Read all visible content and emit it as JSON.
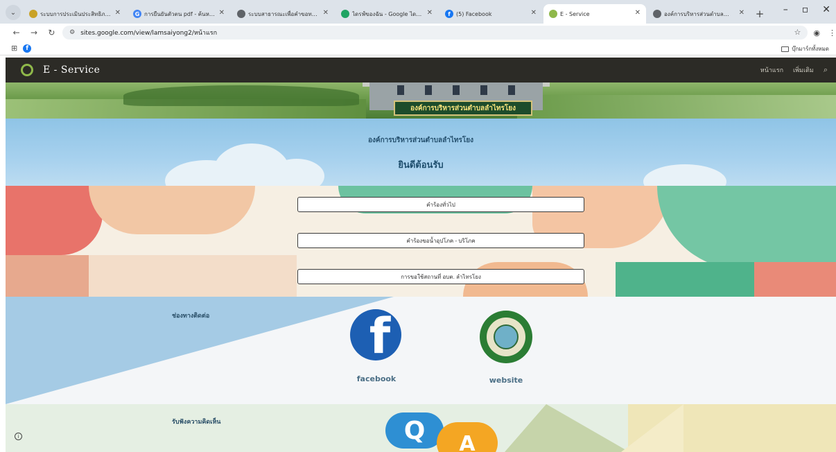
{
  "browser": {
    "tabs": [
      {
        "title": "ระบบการประเมินประสิทธิภาพขององ...",
        "fav_color": "#c9a227",
        "fav_glyph": "",
        "active": false
      },
      {
        "title": "การยืนยันตัวตน pdf - ค้นหาด้วย Go...",
        "fav_color": "#4285f4",
        "fav_glyph": "G",
        "active": false
      },
      {
        "title": "ระบบสาธารณะเพื่อคำขอทางอิเล็กทรอนิกส์ Servi...",
        "fav_color": "#5f6368",
        "fav_glyph": "",
        "active": false
      },
      {
        "title": "ไดรฟ์ของฉัน - Google ไดรฟ์",
        "fav_color": "#1fa463",
        "fav_glyph": "",
        "active": false
      },
      {
        "title": "(5) Facebook",
        "fav_color": "#1877f2",
        "fav_glyph": "f",
        "active": false
      },
      {
        "title": "E - Service",
        "fav_color": "#8fb84a",
        "fav_glyph": "",
        "active": true
      },
      {
        "title": "องค์การบริหารส่วนตำบลลำไทรโยง | ...",
        "fav_color": "#5f6368",
        "fav_glyph": "",
        "active": false
      }
    ],
    "url": "sites.google.com/view/lamsaiyong2/หน้าแรก",
    "bookmark_folder": "บุ๊กมาร์กทั้งหมด"
  },
  "site": {
    "title": "E - Service",
    "nav": [
      "หน้าแรก",
      "เพิ่มเติม"
    ],
    "banner_sign": "องค์การบริหารส่วนตำบลลำไทรโยง"
  },
  "welcome": {
    "org": "องค์การบริหารส่วนตำบลลำไทรโยง",
    "greeting": "ยินดีต้อนรับ"
  },
  "services": [
    {
      "label": "คำร้องทั่วไป"
    },
    {
      "label": "คำร้องขอน้ำอุปโภค - บริโภค"
    },
    {
      "label": "การขอใช้สถานที่ อบต. ลำไทรโยง"
    }
  ],
  "contact": {
    "heading": "ช่องทางติดต่อ",
    "facebook_label": "facebook",
    "website_label": "website"
  },
  "feedback": {
    "heading": "รับฟังความคิดเห็น",
    "q": "Q",
    "a": "A"
  },
  "icons": {
    "facebook": "facebook-icon",
    "website": "org-seal-icon",
    "search": "search-icon"
  },
  "colors": {
    "header_bg": "#2c2b26",
    "accent_green": "#8fb84a",
    "facebook_blue": "#1d5fb3"
  }
}
